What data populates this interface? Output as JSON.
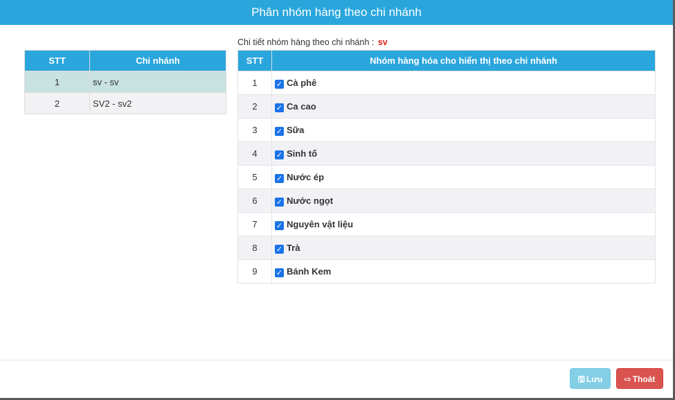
{
  "modal": {
    "title": "Phân nhóm hàng theo chi nhánh"
  },
  "branches": {
    "headers": {
      "stt": "STT",
      "name": "Chi nhánh"
    },
    "rows": [
      {
        "stt": "1",
        "name": "sv - sv",
        "selected": true
      },
      {
        "stt": "2",
        "name": "SV2 - sv2",
        "selected": false
      }
    ]
  },
  "detail": {
    "label": "Chi tiết nhóm hàng theo chi nhánh :",
    "branch_code": "sv"
  },
  "groups": {
    "headers": {
      "stt": "STT",
      "name": "Nhóm hàng hóa cho hiển thị theo chi nhánh"
    },
    "rows": [
      {
        "stt": "1",
        "name": "Cà phê",
        "checked": true
      },
      {
        "stt": "2",
        "name": "Ca cao",
        "checked": true
      },
      {
        "stt": "3",
        "name": "Sữa",
        "checked": true
      },
      {
        "stt": "4",
        "name": "Sinh tố",
        "checked": true
      },
      {
        "stt": "5",
        "name": "Nước ép",
        "checked": true
      },
      {
        "stt": "6",
        "name": "Nước ngọt",
        "checked": true
      },
      {
        "stt": "7",
        "name": "Nguyên vật liệu",
        "checked": true
      },
      {
        "stt": "8",
        "name": "Trà",
        "checked": true
      },
      {
        "stt": "9",
        "name": "Bánh Kem",
        "checked": true
      }
    ]
  },
  "footer": {
    "save_label": "Lưu",
    "save_icon": "floppy-disk-icon",
    "exit_label": "Thoát",
    "exit_icon": "sign-out-icon"
  },
  "colors": {
    "header_blue": "#2aa6dc",
    "selected_row": "#c8e1e1",
    "branch_code_red": "#e0211b",
    "checkbox_blue": "#1a73e8",
    "save_button": "#5bc0de",
    "exit_button": "#d9534f"
  }
}
